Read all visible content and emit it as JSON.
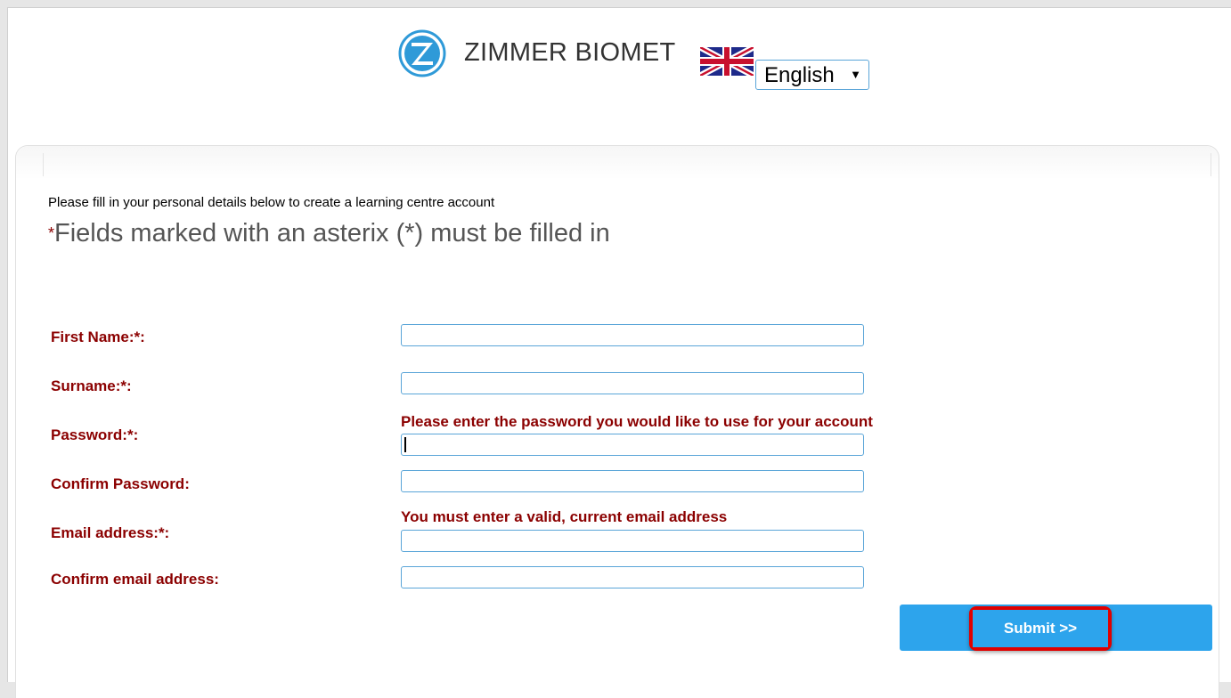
{
  "header": {
    "brand": "ZIMMER BIOMET",
    "language": {
      "selected": "English",
      "arrow": "▼"
    },
    "flag_icon": "uk-flag-icon"
  },
  "intro": "Please fill in your personal details below to create a learning centre account",
  "required_note": {
    "star": "*",
    "text": "Fields marked with an asterix (*) must be filled in"
  },
  "form": {
    "fields": [
      {
        "label": "First Name:*:",
        "value": ""
      },
      {
        "label": "Surname:*:",
        "value": ""
      },
      {
        "label": "Password:*:",
        "value": "",
        "hint": "Please enter the password you would like to use for your account"
      },
      {
        "label": "Confirm Password:",
        "value": ""
      },
      {
        "label": "Email address:*:",
        "value": "",
        "hint": "You must enter a valid, current email address"
      },
      {
        "label": "Confirm email address:",
        "value": ""
      }
    ],
    "submit_label": "Submit >>"
  },
  "colors": {
    "label": "#8b0000",
    "accent": "#2da4ec",
    "highlight": "#e00000"
  }
}
